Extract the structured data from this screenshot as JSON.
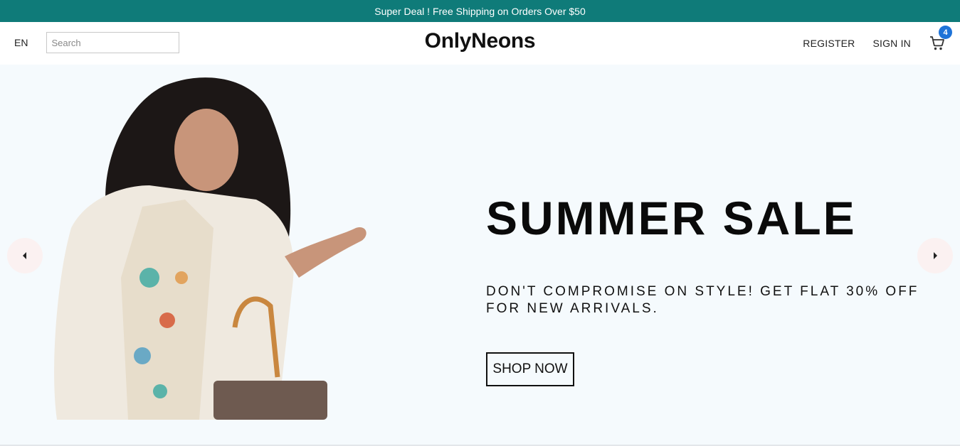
{
  "announcement": {
    "text": "Super Deal ! Free Shipping on Orders Over $50",
    "background": "#0f7b79"
  },
  "header": {
    "language": "EN",
    "search": {
      "placeholder": "Search",
      "value": "",
      "icon": "search-icon"
    },
    "logo": "OnlyNeons",
    "menu": {
      "register": "REGISTER",
      "sign_in": "SIGN IN"
    },
    "cart": {
      "icon": "shopping-cart-icon",
      "count": "4",
      "badge_color": "#1e73d8"
    }
  },
  "hero": {
    "title": "SUMMER SALE",
    "subtitle": "DON'T COMPROMISE ON STYLE! GET FLAT 30% OFF FOR NEW ARRIVALS.",
    "cta": "SHOP NOW",
    "background": "#f5fafd",
    "prev_icon": "caret-left-icon",
    "next_icon": "caret-right-icon"
  }
}
